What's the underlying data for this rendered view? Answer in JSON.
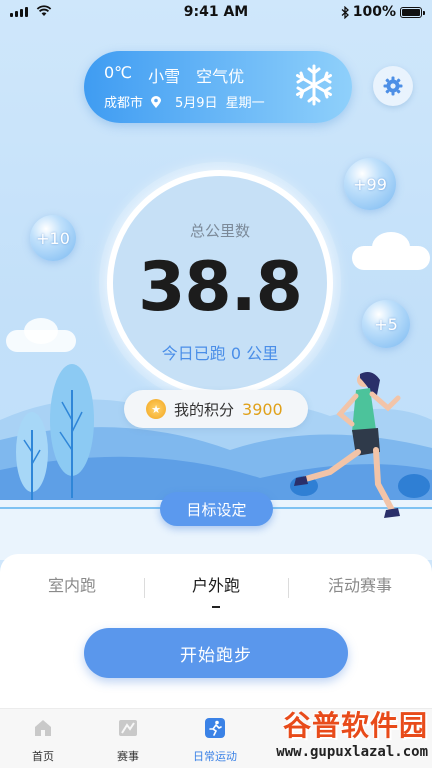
{
  "status_bar": {
    "time": "9:41 AM",
    "battery": "100%"
  },
  "weather": {
    "temperature": "0℃",
    "condition": "小雪",
    "air_quality": "空气优",
    "city": "成都市",
    "date": "5月9日",
    "weekday": "星期一"
  },
  "distance": {
    "label": "总公里数",
    "total": "38.8",
    "today_prefix": "今日已跑",
    "today_value": "0",
    "today_unit": "公里"
  },
  "bubbles": {
    "left": "+10",
    "top_right": "+99",
    "right": "+5"
  },
  "points": {
    "label": "我的积分",
    "value": "3900"
  },
  "goal_button": "目标设定",
  "tabs": [
    {
      "label": "室内跑",
      "active": false
    },
    {
      "label": "户外跑",
      "active": true
    },
    {
      "label": "活动赛事",
      "active": false
    }
  ],
  "start_button": "开始跑步",
  "tab_bar": [
    {
      "label": "首页",
      "icon": "home-icon"
    },
    {
      "label": "赛事",
      "icon": "event-map-icon"
    },
    {
      "label": "日常运动",
      "icon": "running-icon",
      "active": true
    }
  ],
  "watermark": {
    "title": "谷普软件园",
    "url": "www.gupuxlazal.com"
  },
  "colors": {
    "accent": "#5a97ec",
    "points": "#e0a11a",
    "active_tab": "#3b82e6"
  }
}
